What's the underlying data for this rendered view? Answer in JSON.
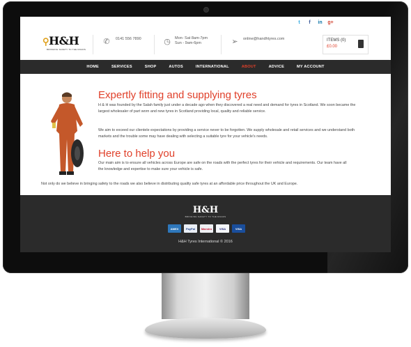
{
  "social": {
    "twitter": "t",
    "facebook": "f",
    "linkedin": "in",
    "googleplus": "g+"
  },
  "header": {
    "logo_text": "H&H",
    "logo_tagline": "BRINGING SAFETY TO THE ROADS",
    "phone": "0141 556 7890",
    "hours_line1": "Mon- Sat 8am-7pm",
    "hours_line2": "Sun - 9am-6pm",
    "email": "online@handhtyres.com",
    "cart_items": "ITEMS (0)",
    "cart_total": "£0.00"
  },
  "nav": [
    "HOME",
    "SERVICES",
    "SHOP",
    "AUTOS",
    "INTERNATIONAL",
    "ABOUT",
    "ADVICE",
    "MY ACCOUNT"
  ],
  "nav_active": "ABOUT",
  "content": {
    "heading1": "Expertly fitting and supplying tyres",
    "para1": "H & H was founded by the Salah family just under a decade ago when they discovered a real need and demand for tyres in Scotland. We soon became the largest wholesaler of part worn and new tyres in Scotland providing local, quality and reliable service.",
    "para2": "We aim to exceed our clientele expectations by providing a service never to be forgotten. We supply wholesale and retail services and we understand both markets and the trouble some may have dealing with selecting a suitable tyre for your vehicle's needs.",
    "heading2": "Here to help you",
    "para3": "Our main aim is to ensure all vehicles across Europe are safe on the roads with the perfect tyres for their vehicle and requirements.  Our team have all the knowledge and expertise to make sure your vehicle is safe.",
    "para4": "Not only do we believe in bringing safety to the roads we also believe in distributing quality safe tyres at an affordable price throughout the UK and Europe."
  },
  "footer": {
    "logo_text": "H&H",
    "logo_tagline": "BRINGING SAFETY TO THE ROADS",
    "cards": [
      "AMEX",
      "PayPal",
      "Maestro",
      "VISA",
      "VISA Electron"
    ],
    "copyright": "H&H Tyres International © 2016"
  },
  "colors": {
    "accent": "#e0402a",
    "nav_bg": "#2b2b2b"
  }
}
